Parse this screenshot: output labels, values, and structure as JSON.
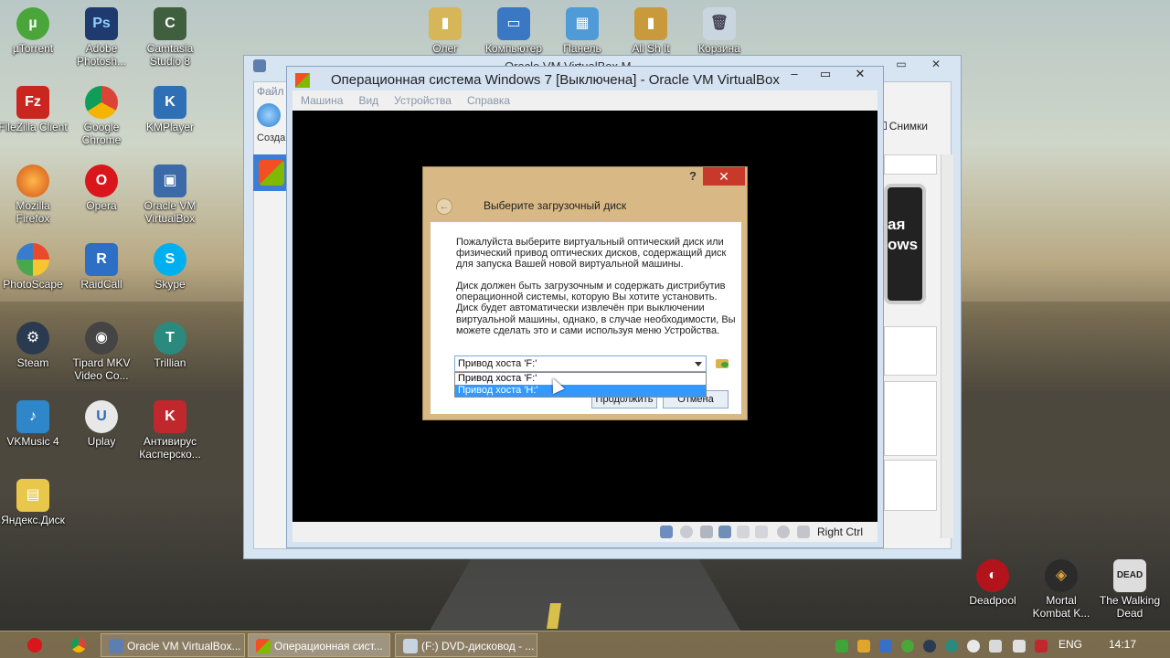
{
  "desktop": {
    "icons_left": [
      {
        "label": "µTorrent",
        "icon": "utorrent-icon"
      },
      {
        "label": "Adobe Photosh...",
        "icon": "photoshop-icon"
      },
      {
        "label": "Camtasia Studio 8",
        "icon": "camtasia-icon"
      },
      {
        "label": "FileZilla Client",
        "icon": "filezilla-icon"
      },
      {
        "label": "Google Chrome",
        "icon": "chrome-icon"
      },
      {
        "label": "KMPlayer",
        "icon": "kmplayer-icon"
      },
      {
        "label": "Mozilla Firefox",
        "icon": "firefox-icon"
      },
      {
        "label": "Opera",
        "icon": "opera-icon"
      },
      {
        "label": "Oracle VM VirtualBox",
        "icon": "virtualbox-icon"
      },
      {
        "label": "PhotoScape",
        "icon": "photoscape-icon"
      },
      {
        "label": "RaidCall",
        "icon": "raidcall-icon"
      },
      {
        "label": "Skype",
        "icon": "skype-icon"
      },
      {
        "label": "Steam",
        "icon": "steam-icon"
      },
      {
        "label": "Tipard MKV Video Co...",
        "icon": "tipard-icon"
      },
      {
        "label": "Trillian",
        "icon": "trillian-icon"
      },
      {
        "label": "VKMusic 4",
        "icon": "vkmusic-icon"
      },
      {
        "label": "Uplay",
        "icon": "uplay-icon"
      },
      {
        "label": "Антивирус Касперско...",
        "icon": "kaspersky-icon"
      },
      {
        "label": "Яндекс.Диск",
        "icon": "yandex-disk-icon"
      }
    ],
    "icons_top": [
      {
        "label": "Олег",
        "icon": "user-folder-icon"
      },
      {
        "label": "Компьютер",
        "icon": "computer-icon"
      },
      {
        "label": "Панель",
        "icon": "control-panel-icon"
      },
      {
        "label": "All Sh It",
        "icon": "folder-icon"
      },
      {
        "label": "Корзина",
        "icon": "recycle-bin-icon"
      }
    ],
    "icons_right": [
      {
        "label": "Deadpool",
        "icon": "deadpool-icon"
      },
      {
        "label": "Mortal Kombat K...",
        "icon": "mortal-kombat-icon"
      },
      {
        "label": "The Walking Dead",
        "icon": "walking-dead-icon"
      }
    ]
  },
  "manager": {
    "title": "Oracle VM VirtualBox М...",
    "menu_file": "Файл",
    "create": "Созда",
    "snapshots": "Снимки",
    "preview_text": "ая ows"
  },
  "vm_window": {
    "title": "Операционная система Windows 7 [Выключена] - Oracle VM VirtualBox",
    "menu": [
      "Машина",
      "Вид",
      "Устройства",
      "Справка"
    ],
    "host_key": "Right Ctrl"
  },
  "dialog": {
    "help": "?",
    "close": "✕",
    "heading": "Выберите загрузочный диск",
    "paragraph1": "Пожалуйста выберите виртуальный оптический диск или физический привод оптических дисков, содержащий диск для запуска Вашей новой виртуальной машины.",
    "paragraph2": "Диск должен быть загрузочным и содержать дистрибутив операционной системы, которую Вы хотите установить. Диск будет автоматически извлечён при выключении виртуальной машины, однако, в случае необходимости, Вы можете сделать это и сами используя меню Устройства.",
    "combo_value": "Привод хоста 'F:'",
    "options": [
      "Привод хоста 'F:'",
      "Привод хоста 'H:'"
    ],
    "continue": "Продолжить",
    "cancel": "Отмена"
  },
  "taskbar": {
    "apps": [
      {
        "label": "Oracle VM VirtualBox...",
        "active": false
      },
      {
        "label": "Операционная сист...",
        "active": true
      },
      {
        "label": "(F:) DVD-дисковод - ...",
        "active": false
      }
    ],
    "lang": "ENG",
    "time": "14:17"
  },
  "colors": {
    "dialog_frame": "#d8b985",
    "selection": "#3399ff",
    "close_red": "#c7392b",
    "taskbar": "#807050"
  }
}
